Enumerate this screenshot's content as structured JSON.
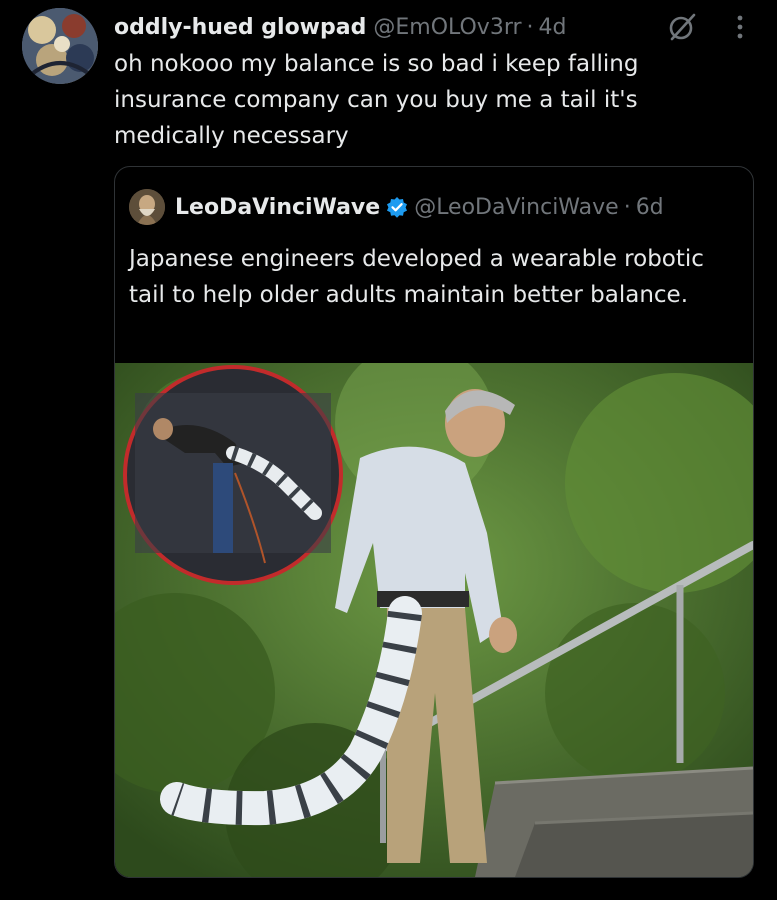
{
  "tweet": {
    "display_name": "oddly-hued glowpad",
    "handle": "@EmOLOv3rr",
    "separator": "·",
    "time": "4d",
    "text": "oh nokooo my balance is so bad i keep falling insurance company can you buy me a tail it's medically necessary"
  },
  "quoted_tweet": {
    "display_name": "LeoDaVinciWave",
    "handle": "@LeoDaVinciWave",
    "separator": "·",
    "time": "6d",
    "text": "Japanese engineers developed a wearable robotic tail to help older adults maintain better balance.",
    "verified_badge_color": "#1d9bf0"
  },
  "icons": {
    "grok": "grok-icon",
    "more": "more-options-icon",
    "verified": "verified-badge-icon"
  },
  "colors": {
    "background": "#000000",
    "text_primary": "#e7e9ea",
    "text_secondary": "#71767b",
    "border": "#2f3336",
    "accent": "#1d9bf0"
  }
}
